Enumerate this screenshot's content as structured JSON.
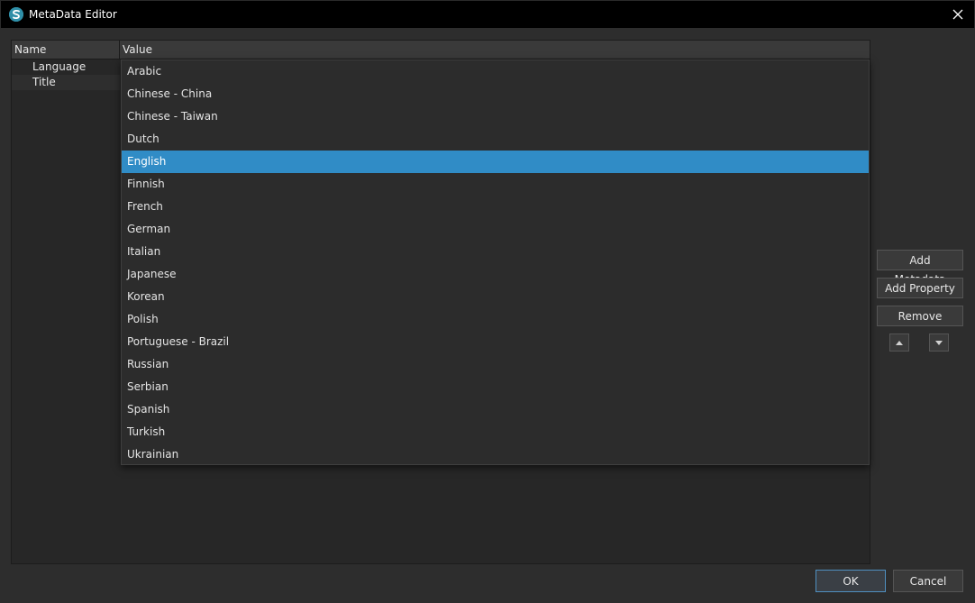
{
  "window": {
    "title": "MetaData Editor",
    "app_icon": "s-logo-icon",
    "close_icon": "close-icon"
  },
  "tree": {
    "columns": [
      "Name",
      "Value"
    ],
    "rows": [
      {
        "name": "Language"
      },
      {
        "name": "Title"
      }
    ]
  },
  "dropdown": {
    "selected": "English",
    "options": [
      "Arabic",
      "Chinese - China",
      "Chinese - Taiwan",
      "Dutch",
      "English",
      "Finnish",
      "French",
      "German",
      "Italian",
      "Japanese",
      "Korean",
      "Polish",
      "Portuguese - Brazil",
      "Russian",
      "Serbian",
      "Spanish",
      "Turkish",
      "Ukrainian"
    ]
  },
  "side_buttons": {
    "add_metadata": "Add Metadata",
    "add_property": "Add Property",
    "remove": "Remove",
    "move_up_icon": "triangle-up-icon",
    "move_down_icon": "triangle-down-icon"
  },
  "footer": {
    "ok": "OK",
    "cancel": "Cancel"
  },
  "colors": {
    "selection": "#308cc6",
    "background": "#2d2d2d",
    "titlebar": "#000000"
  }
}
